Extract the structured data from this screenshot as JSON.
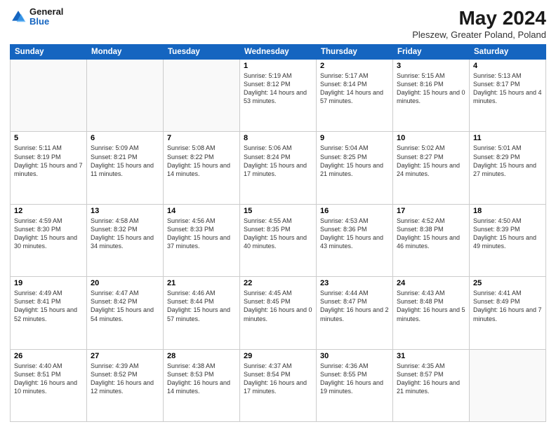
{
  "header": {
    "logo": {
      "general": "General",
      "blue": "Blue"
    },
    "title": "May 2024",
    "subtitle": "Pleszew, Greater Poland, Poland"
  },
  "weekdays": [
    "Sunday",
    "Monday",
    "Tuesday",
    "Wednesday",
    "Thursday",
    "Friday",
    "Saturday"
  ],
  "weeks": [
    [
      {
        "day": "",
        "info": ""
      },
      {
        "day": "",
        "info": ""
      },
      {
        "day": "",
        "info": ""
      },
      {
        "day": "1",
        "info": "Sunrise: 5:19 AM\nSunset: 8:12 PM\nDaylight: 14 hours and 53 minutes."
      },
      {
        "day": "2",
        "info": "Sunrise: 5:17 AM\nSunset: 8:14 PM\nDaylight: 14 hours and 57 minutes."
      },
      {
        "day": "3",
        "info": "Sunrise: 5:15 AM\nSunset: 8:16 PM\nDaylight: 15 hours and 0 minutes."
      },
      {
        "day": "4",
        "info": "Sunrise: 5:13 AM\nSunset: 8:17 PM\nDaylight: 15 hours and 4 minutes."
      }
    ],
    [
      {
        "day": "5",
        "info": "Sunrise: 5:11 AM\nSunset: 8:19 PM\nDaylight: 15 hours and 7 minutes."
      },
      {
        "day": "6",
        "info": "Sunrise: 5:09 AM\nSunset: 8:21 PM\nDaylight: 15 hours and 11 minutes."
      },
      {
        "day": "7",
        "info": "Sunrise: 5:08 AM\nSunset: 8:22 PM\nDaylight: 15 hours and 14 minutes."
      },
      {
        "day": "8",
        "info": "Sunrise: 5:06 AM\nSunset: 8:24 PM\nDaylight: 15 hours and 17 minutes."
      },
      {
        "day": "9",
        "info": "Sunrise: 5:04 AM\nSunset: 8:25 PM\nDaylight: 15 hours and 21 minutes."
      },
      {
        "day": "10",
        "info": "Sunrise: 5:02 AM\nSunset: 8:27 PM\nDaylight: 15 hours and 24 minutes."
      },
      {
        "day": "11",
        "info": "Sunrise: 5:01 AM\nSunset: 8:29 PM\nDaylight: 15 hours and 27 minutes."
      }
    ],
    [
      {
        "day": "12",
        "info": "Sunrise: 4:59 AM\nSunset: 8:30 PM\nDaylight: 15 hours and 30 minutes."
      },
      {
        "day": "13",
        "info": "Sunrise: 4:58 AM\nSunset: 8:32 PM\nDaylight: 15 hours and 34 minutes."
      },
      {
        "day": "14",
        "info": "Sunrise: 4:56 AM\nSunset: 8:33 PM\nDaylight: 15 hours and 37 minutes."
      },
      {
        "day": "15",
        "info": "Sunrise: 4:55 AM\nSunset: 8:35 PM\nDaylight: 15 hours and 40 minutes."
      },
      {
        "day": "16",
        "info": "Sunrise: 4:53 AM\nSunset: 8:36 PM\nDaylight: 15 hours and 43 minutes."
      },
      {
        "day": "17",
        "info": "Sunrise: 4:52 AM\nSunset: 8:38 PM\nDaylight: 15 hours and 46 minutes."
      },
      {
        "day": "18",
        "info": "Sunrise: 4:50 AM\nSunset: 8:39 PM\nDaylight: 15 hours and 49 minutes."
      }
    ],
    [
      {
        "day": "19",
        "info": "Sunrise: 4:49 AM\nSunset: 8:41 PM\nDaylight: 15 hours and 52 minutes."
      },
      {
        "day": "20",
        "info": "Sunrise: 4:47 AM\nSunset: 8:42 PM\nDaylight: 15 hours and 54 minutes."
      },
      {
        "day": "21",
        "info": "Sunrise: 4:46 AM\nSunset: 8:44 PM\nDaylight: 15 hours and 57 minutes."
      },
      {
        "day": "22",
        "info": "Sunrise: 4:45 AM\nSunset: 8:45 PM\nDaylight: 16 hours and 0 minutes."
      },
      {
        "day": "23",
        "info": "Sunrise: 4:44 AM\nSunset: 8:47 PM\nDaylight: 16 hours and 2 minutes."
      },
      {
        "day": "24",
        "info": "Sunrise: 4:43 AM\nSunset: 8:48 PM\nDaylight: 16 hours and 5 minutes."
      },
      {
        "day": "25",
        "info": "Sunrise: 4:41 AM\nSunset: 8:49 PM\nDaylight: 16 hours and 7 minutes."
      }
    ],
    [
      {
        "day": "26",
        "info": "Sunrise: 4:40 AM\nSunset: 8:51 PM\nDaylight: 16 hours and 10 minutes."
      },
      {
        "day": "27",
        "info": "Sunrise: 4:39 AM\nSunset: 8:52 PM\nDaylight: 16 hours and 12 minutes."
      },
      {
        "day": "28",
        "info": "Sunrise: 4:38 AM\nSunset: 8:53 PM\nDaylight: 16 hours and 14 minutes."
      },
      {
        "day": "29",
        "info": "Sunrise: 4:37 AM\nSunset: 8:54 PM\nDaylight: 16 hours and 17 minutes."
      },
      {
        "day": "30",
        "info": "Sunrise: 4:36 AM\nSunset: 8:55 PM\nDaylight: 16 hours and 19 minutes."
      },
      {
        "day": "31",
        "info": "Sunrise: 4:35 AM\nSunset: 8:57 PM\nDaylight: 16 hours and 21 minutes."
      },
      {
        "day": "",
        "info": ""
      }
    ]
  ]
}
